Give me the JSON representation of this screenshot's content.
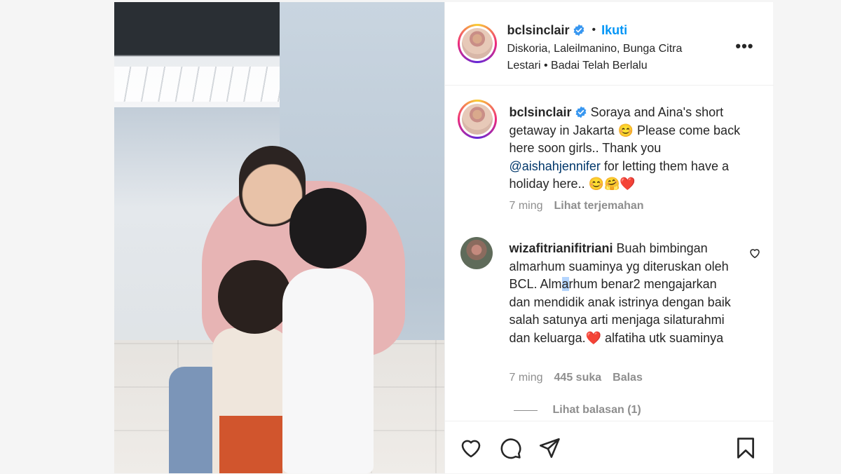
{
  "post": {
    "author": "bclsinclair",
    "follow_label": "Ikuti",
    "separator": "•",
    "audio_text": "Diskoria, Laleilmanino, Bunga Citra Lestari • Badai Telah Berlalu",
    "more_label": "•••"
  },
  "caption": {
    "username": "bclsinclair",
    "text_part1": "Soraya and Aina's short getaway in Jakarta 😊 Please come back here soon girls.. Thank you ",
    "mention": "@aishahjennifer",
    "text_part2": " for letting them have a holiday here.. 😊🤗❤️",
    "time": "7 ming",
    "translate_label": "Lihat terjemahan"
  },
  "comment": {
    "username": "wizafitrianifitriani",
    "text_part1": "Buah bimbingan almarhum suaminya yg diteruskan oleh BCL. Alm",
    "text_selected": "a",
    "text_part2": "rhum benar2 mengajarkan dan mendidik anak istrinya dengan baik salah satunya arti menjaga silaturahmi dan keluarga.❤️ alfatiha utk suaminya",
    "time": "7 ming",
    "likes": "445 suka",
    "reply_label": "Balas",
    "view_replies": "Lihat balasan (1)"
  },
  "icons": {
    "like": "heart-icon",
    "comment": "comment-icon",
    "share": "share-icon",
    "save": "bookmark-icon",
    "verified": "verified-badge-icon"
  },
  "colors": {
    "link_blue": "#0095f6",
    "mention_blue": "#00376b",
    "muted_gray": "#8e8e8e",
    "verified_blue": "#3897f0"
  }
}
